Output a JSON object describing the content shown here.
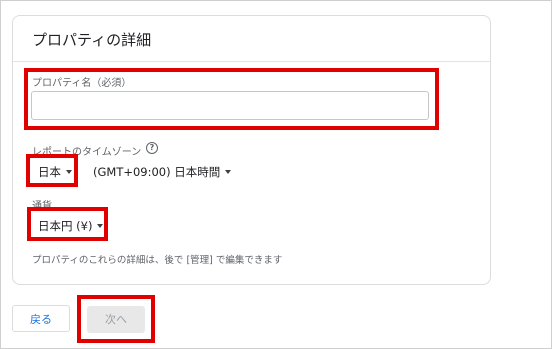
{
  "card": {
    "title": "プロパティの詳細"
  },
  "property_name": {
    "label": "プロパティ名（必須）",
    "value": ""
  },
  "timezone": {
    "label": "レポートのタイムゾーン",
    "help_icon": "help-circle-icon",
    "country": "日本",
    "zone": "(GMT+09:00) 日本時間"
  },
  "currency": {
    "label": "通貨",
    "value": "日本円 (¥)"
  },
  "helper_text": "プロパティのこれらの詳細は、後で [管理] で編集できます",
  "buttons": {
    "back": "戻る",
    "next": "次へ"
  },
  "colors": {
    "highlight": "#e00000",
    "link": "#1a73e8"
  }
}
